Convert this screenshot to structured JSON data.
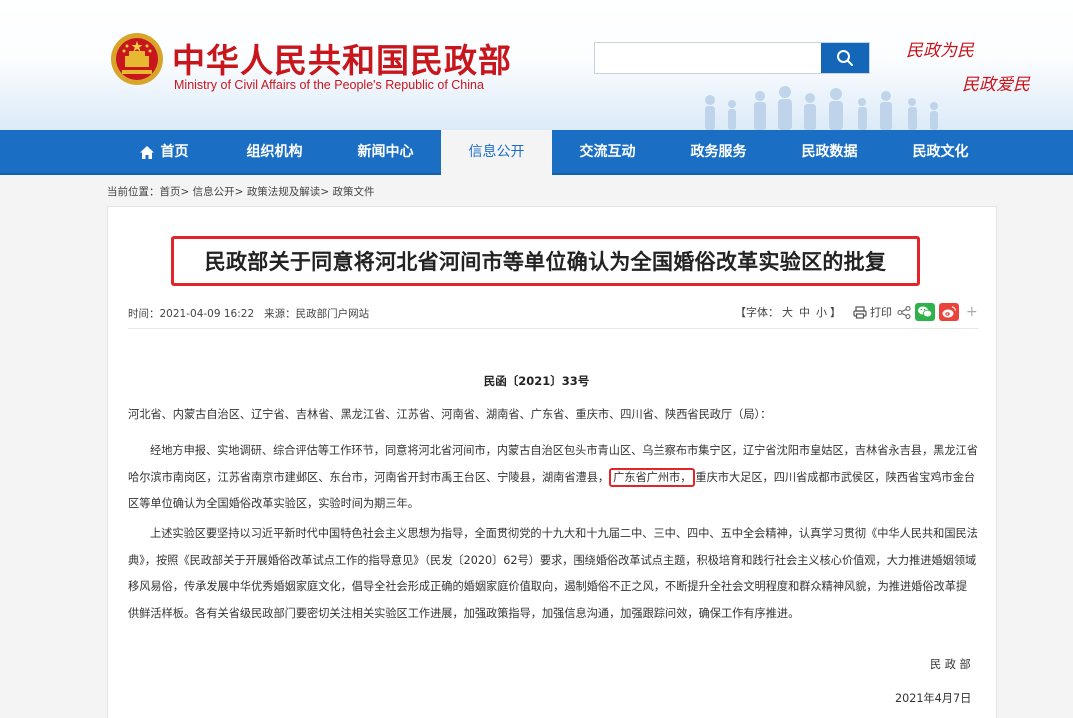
{
  "header": {
    "title": "中华人民共和国民政部",
    "subtitle": "Ministry of Civil Affairs of the People's Republic of China",
    "slogan_line1": "民政为民",
    "slogan_line2": "民政爱民",
    "search": {
      "value": "",
      "placeholder": ""
    },
    "brand_red": "#c8161d",
    "brand_blue": "#1a6fc5"
  },
  "nav": {
    "items": [
      {
        "label": "首页",
        "icon": "home-icon"
      },
      {
        "label": "组织机构"
      },
      {
        "label": "新闻中心"
      },
      {
        "label": "信息公开",
        "active": true
      },
      {
        "label": "交流互动"
      },
      {
        "label": "政务服务"
      },
      {
        "label": "民政数据"
      },
      {
        "label": "民政文化"
      }
    ]
  },
  "breadcrumb": {
    "prefix": "当前位置：",
    "items": [
      "首页",
      "信息公开",
      "政策法规及解读",
      "政策文件"
    ],
    "separator": ">"
  },
  "article": {
    "title": "民政部关于同意将河北省河间市等单位确认为全国婚俗改革实验区的批复",
    "meta": {
      "time_label": "时间：",
      "time_value": "2021-04-09 16:22",
      "source_label": "来源：",
      "source_value": "民政部门户网站",
      "font_label_open": "【字体：",
      "font_large": "大",
      "font_medium": "中",
      "font_small": "小",
      "font_label_close": "】",
      "print_label": "打印",
      "more_label": "+"
    },
    "doc_number": "民函〔2021〕33号",
    "addressees": "河北省、内蒙古自治区、辽宁省、吉林省、黑龙江省、江苏省、河南省、湖南省、广东省、重庆市、四川省、陕西省民政厅（局）：",
    "para1_before": "经地方申报、实地调研、综合评估等工作环节，同意将河北省河间市，内蒙古自治区包头市青山区、乌兰察布市集宁区，辽宁省沈阳市皇姑区，吉林省永吉县，黑龙江省哈尔滨市南岗区，江苏省南京市建邺区、东台市，河南省开封市禹王台区、宁陵县，湖南省澧县，",
    "para1_highlight": "广东省广州市，",
    "para1_after": "重庆市大足区，四川省成都市武侯区，陕西省宝鸡市金台区等单位确认为全国婚俗改革实验区，实验时间为期三年。",
    "para2": "上述实验区要坚持以习近平新时代中国特色社会主义思想为指导，全面贯彻党的十九大和十九届二中、三中、四中、五中全会精神，认真学习贯彻《中华人民共和国民法典》，按照《民政部关于开展婚俗改革试点工作的指导意见》（民发〔2020〕62号）要求，围绕婚俗改革试点主题，积极培育和践行社会主义核心价值观，大力推进婚姻领域移风易俗，传承发展中华优秀婚姻家庭文化，倡导全社会形成正确的婚姻家庭价值取向，遏制婚俗不正之风，不断提升全社会文明程度和群众精神风貌，为推进婚俗改革提供鲜活样板。各有关省级民政部门要密切关注相关实验区工作进展，加强政策指导，加强信息沟通，加强跟踪问效，确保工作有序推进。",
    "signature": "民 政 部",
    "date": "2021年4月7日",
    "highlight_color": "#e3242b"
  }
}
